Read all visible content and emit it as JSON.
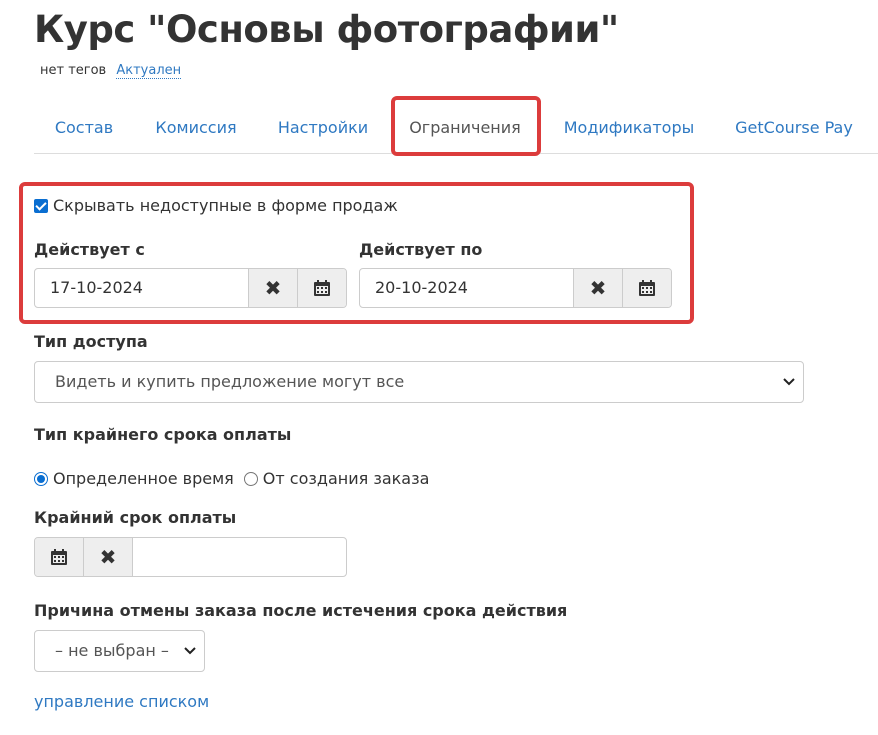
{
  "header": {
    "title": "Курс \"Основы фотографии\"",
    "no_tags": "нет тегов",
    "status_link": "Актуален"
  },
  "tabs": [
    {
      "label": "Состав",
      "active": false
    },
    {
      "label": "Комиссия",
      "active": false
    },
    {
      "label": "Настройки",
      "active": false
    },
    {
      "label": "Ограничения",
      "active": true
    },
    {
      "label": "Модификаторы",
      "active": false
    },
    {
      "label": "GetCourse Pay",
      "active": false
    }
  ],
  "restrictions": {
    "hide_unavailable": {
      "label": "Скрывать недоступные в форме продаж",
      "checked": true
    },
    "valid_from": {
      "label": "Действует с",
      "value": "17-10-2024"
    },
    "valid_to": {
      "label": "Действует по",
      "value": "20-10-2024"
    }
  },
  "access_type": {
    "label": "Тип доступа",
    "selected": "Видеть и купить предложение могут все"
  },
  "payment_deadline_type": {
    "label": "Тип крайнего срока оплаты",
    "options": [
      {
        "label": "Определенное время",
        "selected": true
      },
      {
        "label": "От создания заказа",
        "selected": false
      }
    ]
  },
  "payment_deadline": {
    "label": "Крайний срок оплаты",
    "value": ""
  },
  "cancel_reason": {
    "label": "Причина отмены заказа после истечения срока действия",
    "selected": "– не выбран –",
    "manage_link": "управление списком"
  },
  "icons": {
    "clear": "times-icon",
    "calendar": "calendar-icon",
    "dropdown": "chevron-down-icon"
  },
  "colors": {
    "link": "#2f79c2",
    "highlight": "#dc3c3c",
    "checkbox": "#0a6ed1"
  }
}
